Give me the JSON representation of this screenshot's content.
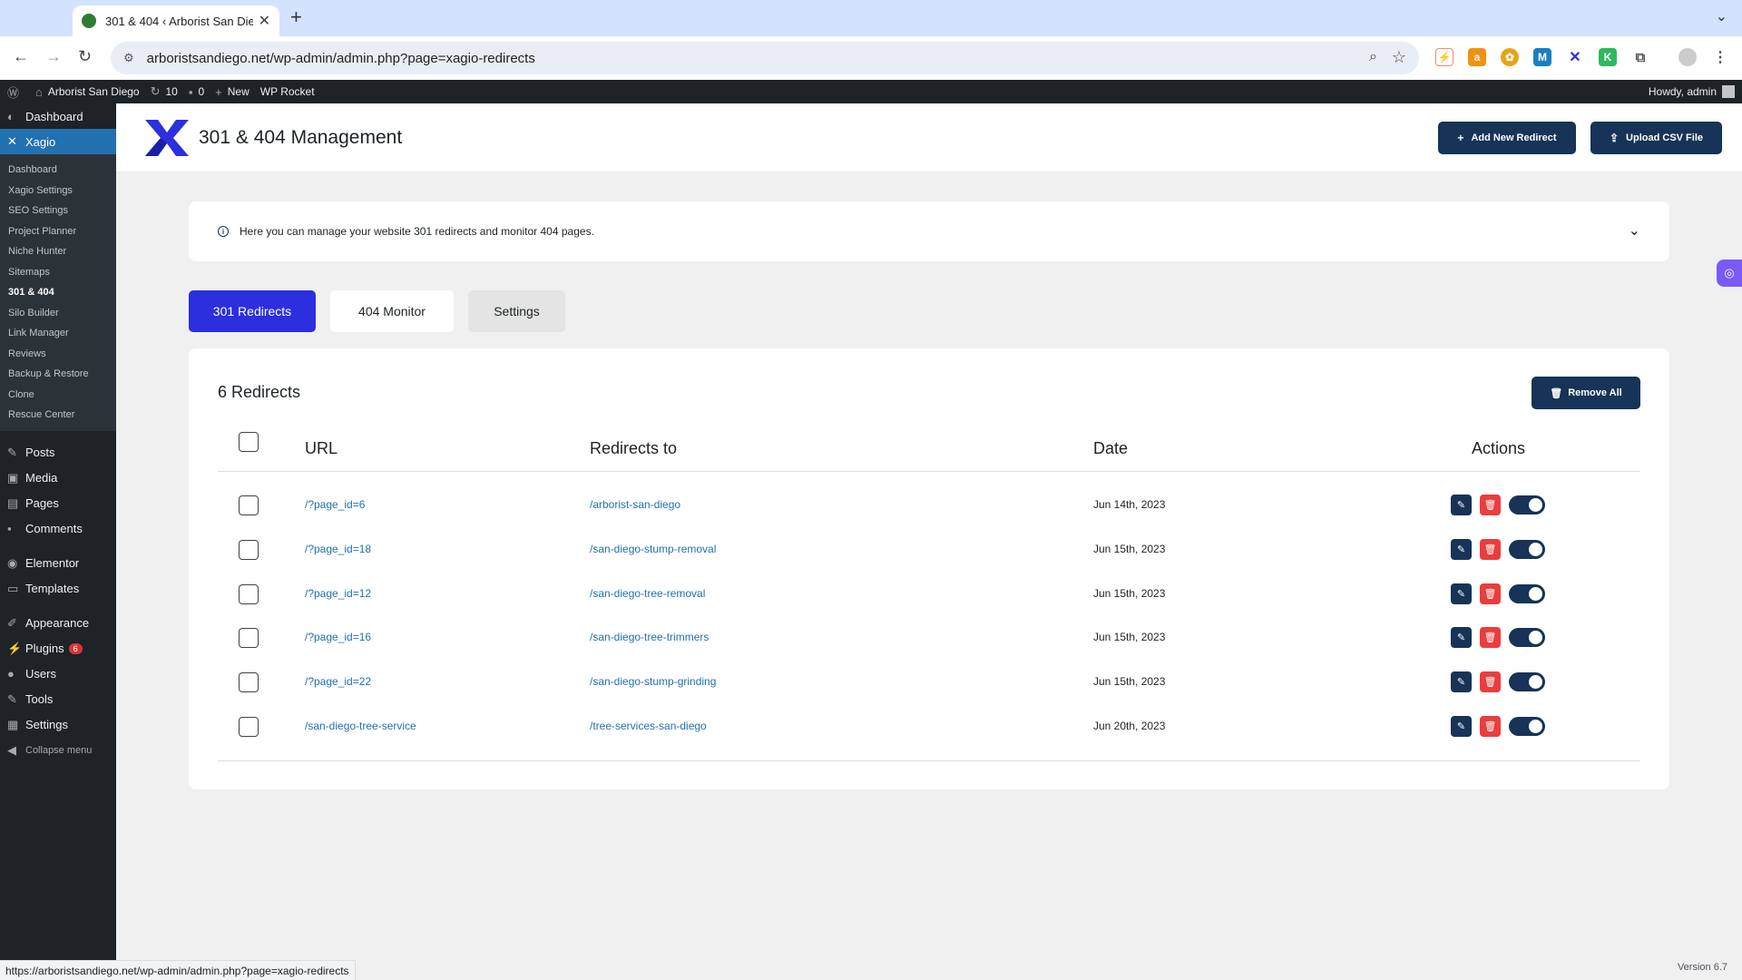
{
  "browser": {
    "tab_title": "301 & 404 ‹ Arborist San Diego",
    "url": "arboristsandiego.net/wp-admin/admin.php?page=xagio-redirects",
    "status_url": "https://arboristsandiego.net/wp-admin/admin.php?page=xagio-redirects"
  },
  "adminbar": {
    "site_name": "Arborist San Diego",
    "updates_count": "10",
    "comments_count": "0",
    "new_label": "New",
    "wp_rocket": "WP Rocket",
    "howdy": "Howdy, admin"
  },
  "sidebar": {
    "dashboard": "Dashboard",
    "xagio": "Xagio",
    "sub_items": [
      "Dashboard",
      "Xagio Settings",
      "SEO Settings",
      "Project Planner",
      "Niche Hunter",
      "Sitemaps",
      "301 & 404",
      "Silo Builder",
      "Link Manager",
      "Reviews",
      "Backup & Restore",
      "Clone",
      "Rescue Center"
    ],
    "posts": "Posts",
    "media": "Media",
    "pages": "Pages",
    "comments": "Comments",
    "elementor": "Elementor",
    "templates": "Templates",
    "appearance": "Appearance",
    "plugins": "Plugins",
    "plugins_badge": "6",
    "users": "Users",
    "tools": "Tools",
    "settings": "Settings",
    "collapse": "Collapse menu"
  },
  "header": {
    "title": "301 & 404 Management",
    "add_redirect": "Add New Redirect",
    "upload_csv": "Upload CSV File"
  },
  "info": {
    "text": "Here you can manage your website 301 redirects and monitor 404 pages."
  },
  "tabs": {
    "redirects": "301 Redirects",
    "monitor": "404 Monitor",
    "settings": "Settings"
  },
  "table": {
    "count_label": "6 Redirects",
    "remove_all": "Remove All",
    "columns": {
      "url": "URL",
      "redirects_to": "Redirects to",
      "date": "Date",
      "actions": "Actions"
    },
    "rows": [
      {
        "url": "/?page_id=6",
        "target": "/arborist-san-diego",
        "date": "Jun 14th, 2023"
      },
      {
        "url": "/?page_id=18",
        "target": "/san-diego-stump-removal",
        "date": "Jun 15th, 2023"
      },
      {
        "url": "/?page_id=12",
        "target": "/san-diego-tree-removal",
        "date": "Jun 15th, 2023"
      },
      {
        "url": "/?page_id=16",
        "target": "/san-diego-tree-trimmers",
        "date": "Jun 15th, 2023"
      },
      {
        "url": "/?page_id=22",
        "target": "/san-diego-stump-grinding",
        "date": "Jun 15th, 2023"
      },
      {
        "url": "/san-diego-tree-service",
        "target": "/tree-services-san-diego",
        "date": "Jun 20th, 2023"
      }
    ]
  },
  "footer": {
    "version": "Version 6.7"
  },
  "colors": {
    "accent": "#2b2fde",
    "dark_button": "#173357",
    "danger": "#ea3d3d",
    "wp_blue": "#2271b1"
  }
}
